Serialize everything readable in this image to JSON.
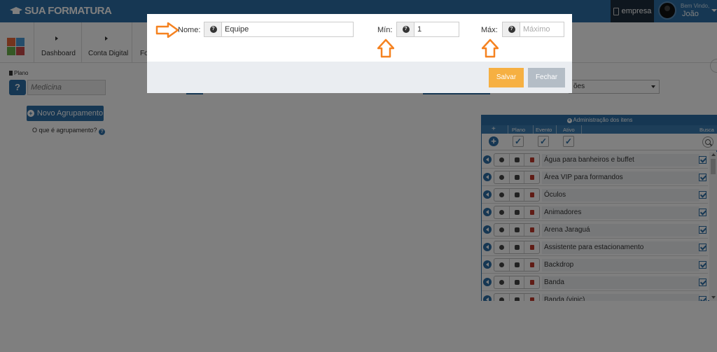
{
  "topbar": {
    "logo_text": "SUA FORMATURA",
    "empresa_label": "empresa",
    "welcome": "Bem Vindo,",
    "user_name": "João"
  },
  "nav": {
    "items": [
      {
        "label": "Dashboard"
      },
      {
        "label": "Conta Digital"
      },
      {
        "label": "Fo"
      }
    ]
  },
  "left_panel": {
    "plano_label": "Plano",
    "plano_help": "?",
    "plano_value": "Medicina",
    "novo_button": "Novo Agrupamento",
    "oque_link": "O que é agrupamento?"
  },
  "background": {
    "select_value": "ões"
  },
  "admin": {
    "title": "Administração dos itens",
    "columns": {
      "plano": "Plano",
      "evento": "Evento",
      "ativo": "Ativo",
      "busca": "Busca"
    },
    "items": [
      {
        "name": "Água para banheiros e buffet"
      },
      {
        "name": "Área VIP para formandos"
      },
      {
        "name": "Óculos"
      },
      {
        "name": "Animadores"
      },
      {
        "name": "Arena Jaraguá"
      },
      {
        "name": "Assistente para estacionamento"
      },
      {
        "name": "Backdrop"
      },
      {
        "name": "Banda"
      },
      {
        "name": "Banda (vinic)"
      }
    ]
  },
  "modal": {
    "nome_label": "Nome:",
    "nome_value": "Equipe",
    "min_label": "Mín:",
    "min_value": "1",
    "max_label": "Máx:",
    "max_placeholder": "Máximo",
    "help_symbol": "?",
    "save_label": "Salvar",
    "close_label": "Fechar"
  },
  "colors": {
    "primary": "#2c6fa6",
    "save": "#f6b042",
    "close": "#b4bdc6",
    "annotation_arrow": "#f58220"
  }
}
